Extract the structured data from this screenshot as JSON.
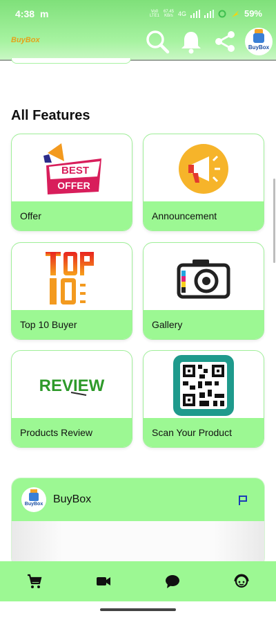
{
  "status": {
    "time": "4:38",
    "app_indicator": "m",
    "net_speed": "67.45\nKB/s",
    "network": "4G",
    "volte": "Vo0\nLTE1",
    "battery": "59%"
  },
  "header": {
    "logo_text": "BuyBox",
    "avatar_label": "BuyBox"
  },
  "section": {
    "title": "All Features"
  },
  "features": [
    {
      "label": "Offer",
      "icon": "best-offer-icon"
    },
    {
      "label": "Announcement",
      "icon": "megaphone-icon"
    },
    {
      "label": "Top 10 Buyer",
      "icon": "top-10-icon"
    },
    {
      "label": "Gallery",
      "icon": "camera-icon"
    },
    {
      "label": "Products Review",
      "icon": "review-icon"
    },
    {
      "label": "Scan Your Product",
      "icon": "qr-code-icon"
    }
  ],
  "feed": {
    "name": "BuyBox",
    "logo_label": "BuyBox"
  },
  "bottom_nav": [
    "cart-icon",
    "video-icon",
    "chat-icon",
    "support-icon"
  ],
  "colors": {
    "accent_green": "#9cf893",
    "header_green": "#7fe07a",
    "brand_blue": "#1c4fa3",
    "brand_orange": "#f3a327"
  }
}
